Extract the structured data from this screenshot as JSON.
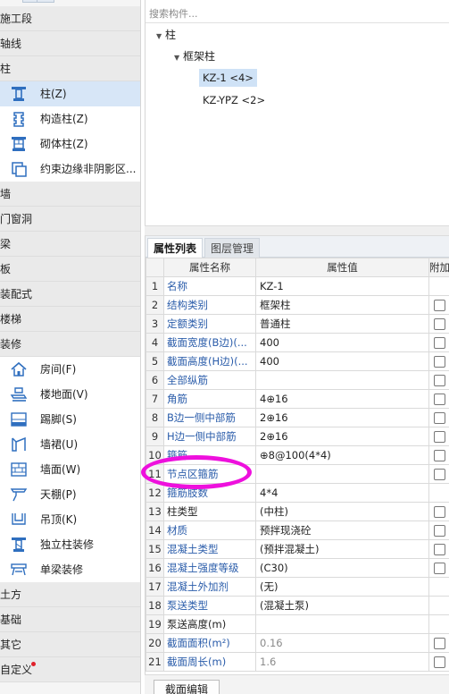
{
  "nav": {
    "categories": [
      {
        "label": "施工段"
      },
      {
        "label": "轴线"
      },
      {
        "label": "柱"
      },
      {
        "label": "墙"
      },
      {
        "label": "门窗洞"
      },
      {
        "label": "梁"
      },
      {
        "label": "板"
      },
      {
        "label": "装配式"
      },
      {
        "label": "楼梯"
      },
      {
        "label": "装修"
      },
      {
        "label": "土方"
      },
      {
        "label": "基础"
      },
      {
        "label": "其它"
      },
      {
        "label": "自定义"
      }
    ],
    "column_items": [
      {
        "label": "柱(Z)",
        "icon": "column-icon"
      },
      {
        "label": "构造柱(Z)",
        "icon": "constructional-column-icon"
      },
      {
        "label": "砌体柱(Z)",
        "icon": "masonry-column-icon"
      },
      {
        "label": "约束边缘非阴影区...",
        "icon": "edge-region-icon"
      }
    ],
    "decoration_items": [
      {
        "label": "房间(F)",
        "icon": "room-icon"
      },
      {
        "label": "楼地面(V)",
        "icon": "floor-icon"
      },
      {
        "label": "踢脚(S)",
        "icon": "skirting-icon"
      },
      {
        "label": "墙裙(U)",
        "icon": "wainscot-icon"
      },
      {
        "label": "墙面(W)",
        "icon": "wall-surface-icon"
      },
      {
        "label": "天棚(P)",
        "icon": "ceiling-icon"
      },
      {
        "label": "吊顶(K)",
        "icon": "suspended-ceiling-icon"
      },
      {
        "label": "独立柱装修",
        "icon": "column-finish-icon"
      },
      {
        "label": "单梁装修",
        "icon": "beam-finish-icon"
      }
    ]
  },
  "tree": {
    "search_placeholder": "搜索构件...",
    "root": "柱",
    "group": "框架柱",
    "items": [
      "KZ-1 <4>",
      "KZ-YPZ <2>"
    ]
  },
  "props": {
    "tabs": [
      "属性列表",
      "图层管理"
    ],
    "headers": [
      "属性名称",
      "属性值",
      "附加"
    ],
    "rows": [
      {
        "num": "1",
        "name": "名称",
        "value": "KZ-1",
        "link": true,
        "muted": false,
        "check": false
      },
      {
        "num": "2",
        "name": "结构类别",
        "value": "框架柱",
        "link": true,
        "muted": false,
        "check": true
      },
      {
        "num": "3",
        "name": "定额类别",
        "value": "普通柱",
        "link": true,
        "muted": false,
        "check": true
      },
      {
        "num": "4",
        "name": "截面宽度(B边)(...",
        "value": "400",
        "link": true,
        "muted": false,
        "check": true
      },
      {
        "num": "5",
        "name": "截面高度(H边)(...",
        "value": "400",
        "link": true,
        "muted": false,
        "check": true
      },
      {
        "num": "6",
        "name": "全部纵筋",
        "value": "",
        "link": true,
        "muted": false,
        "check": true
      },
      {
        "num": "7",
        "name": "角筋",
        "value": "4⊕16",
        "link": true,
        "muted": false,
        "check": true
      },
      {
        "num": "8",
        "name": "B边一侧中部筋",
        "value": "2⊕16",
        "link": true,
        "muted": false,
        "check": true
      },
      {
        "num": "9",
        "name": "H边一侧中部筋",
        "value": "2⊕16",
        "link": true,
        "muted": false,
        "check": true
      },
      {
        "num": "10",
        "name": "箍筋",
        "value": "⊕8@100(4*4)",
        "link": true,
        "muted": false,
        "check": true
      },
      {
        "num": "11",
        "name": "节点区箍筋",
        "value": "",
        "link": true,
        "muted": false,
        "check": true
      },
      {
        "num": "12",
        "name": "箍筋肢数",
        "value": "4*4",
        "link": true,
        "muted": false,
        "check": false
      },
      {
        "num": "13",
        "name": "柱类型",
        "value": "(中柱)",
        "link": false,
        "muted": false,
        "check": true
      },
      {
        "num": "14",
        "name": "材质",
        "value": "预拌现浇砼",
        "link": true,
        "muted": false,
        "check": true
      },
      {
        "num": "15",
        "name": "混凝土类型",
        "value": "(预拌混凝土)",
        "link": true,
        "muted": false,
        "check": true
      },
      {
        "num": "16",
        "name": "混凝土强度等级",
        "value": "(C30)",
        "link": true,
        "muted": false,
        "check": true
      },
      {
        "num": "17",
        "name": "混凝土外加剂",
        "value": "(无)",
        "link": true,
        "muted": false,
        "check": false
      },
      {
        "num": "18",
        "name": "泵送类型",
        "value": "(混凝土泵)",
        "link": true,
        "muted": false,
        "check": false
      },
      {
        "num": "19",
        "name": "泵送高度(m)",
        "value": "",
        "link": false,
        "muted": false,
        "check": false
      },
      {
        "num": "20",
        "name": "截面面积(m²)",
        "value": "0.16",
        "link": true,
        "muted": true,
        "check": true
      },
      {
        "num": "21",
        "name": "截面周长(m)",
        "value": "1.6",
        "link": true,
        "muted": true,
        "check": true
      }
    ]
  },
  "footer": {
    "section_edit": "截面编辑"
  },
  "colors": {
    "accent": "#2a5caa",
    "selection": "#d7e6f7",
    "annotation": "#ee10dd",
    "badge": "#e0212b"
  }
}
